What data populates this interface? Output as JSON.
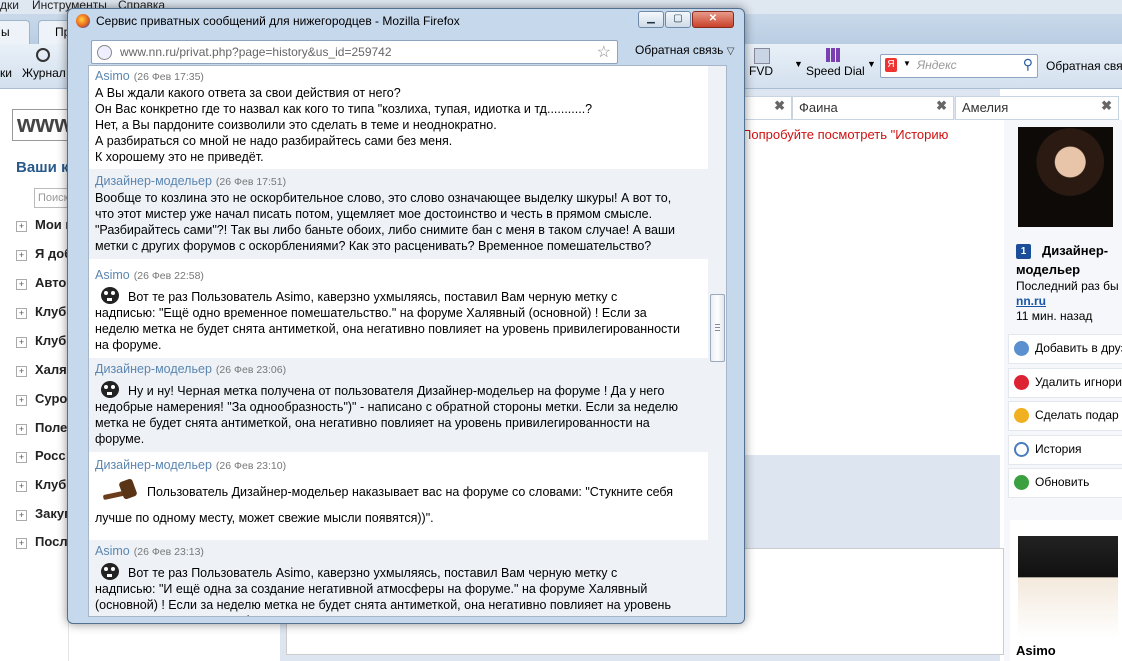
{
  "background_browser": {
    "menu": [
      "дки",
      "Инструменты",
      "Справка"
    ],
    "tabs": [
      "ы",
      "Пр"
    ],
    "toolbar": {
      "journal_label": "Журнал",
      "fvd_label": "FVD",
      "speed_dial_label": "Speed Dial",
      "search_placeholder": "Яндекс",
      "feedback_label": "Обратная связ"
    },
    "site_logo_fragment": "www",
    "left_heading": "Ваши к",
    "left_search_placeholder": "Поиск",
    "left_items": [
      "Мои к",
      "Я доб",
      "Авто",
      "Клуб",
      "Клуб",
      "Халя",
      "Суро",
      "Поле",
      "Росс",
      "Клуб",
      "Закуп",
      "Посл"
    ],
    "chat_tabs": [
      "Фаина",
      "Амелия"
    ],
    "notice_text": "Попробуйте посмотреть \"Историю",
    "profile": {
      "name": "Дизайнер-моделье р",
      "name_line1": "Дизайнер-",
      "name_line2": "модельер",
      "rank": "1",
      "last_seen_label": "Последний раз бы",
      "site_link": "nn.ru",
      "time_ago": "11 мин. назад"
    },
    "actions": [
      "Добавить в друз",
      "Удалить игнори",
      "Сделать подар",
      "История",
      "Обновить"
    ],
    "profile2_name": "Asimo"
  },
  "popup": {
    "title": "Сервис приватных сообщений для нижегородцев - Mozilla Firefox",
    "url": "www.nn.ru/privat.php?page=history&us_id=259742",
    "feedback_label": "Обратная связь",
    "messages": [
      {
        "author": "Asimo",
        "date": "(26 Фев 17:35)",
        "text": "А Вы ждали какого ответа за свои действия от него?\nОн Вас конкретно где то назвал как кого то типа \"козлиха, тупая, идиотка и тд...........?\nНет, а Вы пардоните соизволили это сделать в теме и неоднократно.\nА разбираться со мной не надо разбирайтесь сами без меня.\nК хорошему это не приведёт."
      },
      {
        "author": "Дизайнер-модельер",
        "date": "(26 Фев 17:51)",
        "text": "Вообще то козлина это не оскорбительное слово, это слово означающее выделку шкуры! А вот то,\nчто этот мистер уже начал писать потом, ущемляет мое достоинство и честь в прямом смысле.\n\"Разбирайтесь сами\"?! Так вы либо баньте обоих, либо снимите бан с меня в таком случае! А ваши\nметки с других форумов с оскорблениями? Как это расценивать? Временное помешательство?"
      },
      {
        "author": "Asimo",
        "date": "(26 Фев 22:58)",
        "icon": "skull-icon",
        "first_line": "Вот те раз Пользователь Asimo, каверзно ухмыляясь, поставил Вам черную метку с",
        "text": "надписью: \"Ещё одно временное помешательство.\" на форуме Халявный (основной) ! Если за\nнеделю метка не будет снята антиметкой, она негативно повлияет на уровень привилегированности\nна форуме."
      },
      {
        "author": "Дизайнер-модельер",
        "date": "(26 Фев 23:06)",
        "icon": "skull-icon",
        "first_line": "Ну и ну! Черная метка получена от пользователя Дизайнер-модельер на форуме ! Да у него",
        "text": "недобрые намерения! \"За однообразность\")\" - написано с обратной стороны метки. Если за неделю\nметка не будет снята антиметкой, она негативно повлияет на уровень привилегированности на\nфоруме."
      },
      {
        "author": "Дизайнер-модельер",
        "date": "(26 Фев 23:10)",
        "icon": "gavel-icon",
        "first_line": "Пользователь Дизайнер-модельер наказывает вас на форуме со словами: \"Стукните себя",
        "text": "лучше по одному месту, может свежие мысли появятся))\"."
      },
      {
        "author": "Asimo",
        "date": "(26 Фев 23:13)",
        "icon": "skull-icon",
        "first_line": "Вот те раз Пользователь Asimo, каверзно ухмыляясь, поставил Вам черную метку с",
        "text": "надписью: \"И ещё одна за создание негативной атмосферы на форуме.\" на форуме Халявный\n(основной) ! Если за неделю метка не будет снята антиметкой, она негативно повлияет на уровень\nпривилегированности на форуме."
      }
    ]
  }
}
